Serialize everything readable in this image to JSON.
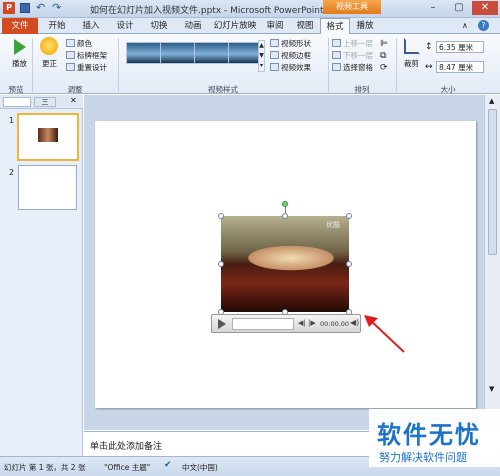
{
  "window": {
    "title": "如何在幻灯片加入视频文件.pptx - Microsoft PowerPoint",
    "context_tool": "视频工具"
  },
  "tabs": [
    "文件",
    "开始",
    "插入",
    "设计",
    "切换",
    "动画",
    "幻灯片放映",
    "审阅",
    "视图",
    "格式",
    "播放"
  ],
  "ribbon": {
    "preview_label": "播放",
    "adjust": {
      "correct": "更正",
      "color": "颜色",
      "poster_frame": "标牌框架",
      "reset": "重置设计"
    },
    "styles": {
      "shape": "视频形状",
      "border": "视频边框",
      "effects": "视频效果"
    },
    "arrange": {
      "bring_forward": "上移一层",
      "send_backward": "下移一层",
      "selection_pane": "选择窗格"
    },
    "crop": "裁剪",
    "size": {
      "height": "6.35 厘米",
      "width": "8.47 厘米"
    },
    "groups": {
      "preview": "预览",
      "adjust": "调整",
      "video_styles": "视频样式",
      "arrange": "排列",
      "size": "大小"
    }
  },
  "panel": {
    "tabs": [
      "",
      "三"
    ],
    "slides": [
      "1",
      "2"
    ]
  },
  "video": {
    "time": "00:00.00",
    "watermark": "优酷"
  },
  "notes": "单击此处添加备注",
  "status": {
    "slide": "幻灯片 第 1 张，共 2 张",
    "theme": "\"Office 主题\"",
    "lang": "中文(中国)"
  },
  "brand": {
    "title": "软件无忧",
    "subtitle": "努力解决软件问题"
  }
}
